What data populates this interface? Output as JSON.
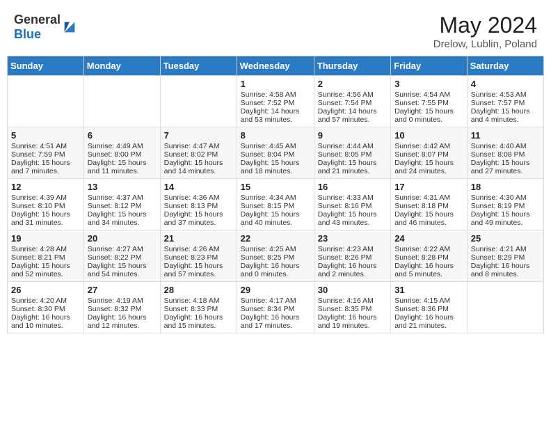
{
  "header": {
    "logo_general": "General",
    "logo_blue": "Blue",
    "month_year": "May 2024",
    "location": "Drelow, Lublin, Poland"
  },
  "days_of_week": [
    "Sunday",
    "Monday",
    "Tuesday",
    "Wednesday",
    "Thursday",
    "Friday",
    "Saturday"
  ],
  "weeks": [
    [
      {
        "day": "",
        "info": ""
      },
      {
        "day": "",
        "info": ""
      },
      {
        "day": "",
        "info": ""
      },
      {
        "day": "1",
        "info": "Sunrise: 4:58 AM\nSunset: 7:52 PM\nDaylight: 14 hours and 53 minutes."
      },
      {
        "day": "2",
        "info": "Sunrise: 4:56 AM\nSunset: 7:54 PM\nDaylight: 14 hours and 57 minutes."
      },
      {
        "day": "3",
        "info": "Sunrise: 4:54 AM\nSunset: 7:55 PM\nDaylight: 15 hours and 0 minutes."
      },
      {
        "day": "4",
        "info": "Sunrise: 4:53 AM\nSunset: 7:57 PM\nDaylight: 15 hours and 4 minutes."
      }
    ],
    [
      {
        "day": "5",
        "info": "Sunrise: 4:51 AM\nSunset: 7:59 PM\nDaylight: 15 hours and 7 minutes."
      },
      {
        "day": "6",
        "info": "Sunrise: 4:49 AM\nSunset: 8:00 PM\nDaylight: 15 hours and 11 minutes."
      },
      {
        "day": "7",
        "info": "Sunrise: 4:47 AM\nSunset: 8:02 PM\nDaylight: 15 hours and 14 minutes."
      },
      {
        "day": "8",
        "info": "Sunrise: 4:45 AM\nSunset: 8:04 PM\nDaylight: 15 hours and 18 minutes."
      },
      {
        "day": "9",
        "info": "Sunrise: 4:44 AM\nSunset: 8:05 PM\nDaylight: 15 hours and 21 minutes."
      },
      {
        "day": "10",
        "info": "Sunrise: 4:42 AM\nSunset: 8:07 PM\nDaylight: 15 hours and 24 minutes."
      },
      {
        "day": "11",
        "info": "Sunrise: 4:40 AM\nSunset: 8:08 PM\nDaylight: 15 hours and 27 minutes."
      }
    ],
    [
      {
        "day": "12",
        "info": "Sunrise: 4:39 AM\nSunset: 8:10 PM\nDaylight: 15 hours and 31 minutes."
      },
      {
        "day": "13",
        "info": "Sunrise: 4:37 AM\nSunset: 8:12 PM\nDaylight: 15 hours and 34 minutes."
      },
      {
        "day": "14",
        "info": "Sunrise: 4:36 AM\nSunset: 8:13 PM\nDaylight: 15 hours and 37 minutes."
      },
      {
        "day": "15",
        "info": "Sunrise: 4:34 AM\nSunset: 8:15 PM\nDaylight: 15 hours and 40 minutes."
      },
      {
        "day": "16",
        "info": "Sunrise: 4:33 AM\nSunset: 8:16 PM\nDaylight: 15 hours and 43 minutes."
      },
      {
        "day": "17",
        "info": "Sunrise: 4:31 AM\nSunset: 8:18 PM\nDaylight: 15 hours and 46 minutes."
      },
      {
        "day": "18",
        "info": "Sunrise: 4:30 AM\nSunset: 8:19 PM\nDaylight: 15 hours and 49 minutes."
      }
    ],
    [
      {
        "day": "19",
        "info": "Sunrise: 4:28 AM\nSunset: 8:21 PM\nDaylight: 15 hours and 52 minutes."
      },
      {
        "day": "20",
        "info": "Sunrise: 4:27 AM\nSunset: 8:22 PM\nDaylight: 15 hours and 54 minutes."
      },
      {
        "day": "21",
        "info": "Sunrise: 4:26 AM\nSunset: 8:23 PM\nDaylight: 15 hours and 57 minutes."
      },
      {
        "day": "22",
        "info": "Sunrise: 4:25 AM\nSunset: 8:25 PM\nDaylight: 16 hours and 0 minutes."
      },
      {
        "day": "23",
        "info": "Sunrise: 4:23 AM\nSunset: 8:26 PM\nDaylight: 16 hours and 2 minutes."
      },
      {
        "day": "24",
        "info": "Sunrise: 4:22 AM\nSunset: 8:28 PM\nDaylight: 16 hours and 5 minutes."
      },
      {
        "day": "25",
        "info": "Sunrise: 4:21 AM\nSunset: 8:29 PM\nDaylight: 16 hours and 8 minutes."
      }
    ],
    [
      {
        "day": "26",
        "info": "Sunrise: 4:20 AM\nSunset: 8:30 PM\nDaylight: 16 hours and 10 minutes."
      },
      {
        "day": "27",
        "info": "Sunrise: 4:19 AM\nSunset: 8:32 PM\nDaylight: 16 hours and 12 minutes."
      },
      {
        "day": "28",
        "info": "Sunrise: 4:18 AM\nSunset: 8:33 PM\nDaylight: 16 hours and 15 minutes."
      },
      {
        "day": "29",
        "info": "Sunrise: 4:17 AM\nSunset: 8:34 PM\nDaylight: 16 hours and 17 minutes."
      },
      {
        "day": "30",
        "info": "Sunrise: 4:16 AM\nSunset: 8:35 PM\nDaylight: 16 hours and 19 minutes."
      },
      {
        "day": "31",
        "info": "Sunrise: 4:15 AM\nSunset: 8:36 PM\nDaylight: 16 hours and 21 minutes."
      },
      {
        "day": "",
        "info": ""
      }
    ]
  ]
}
